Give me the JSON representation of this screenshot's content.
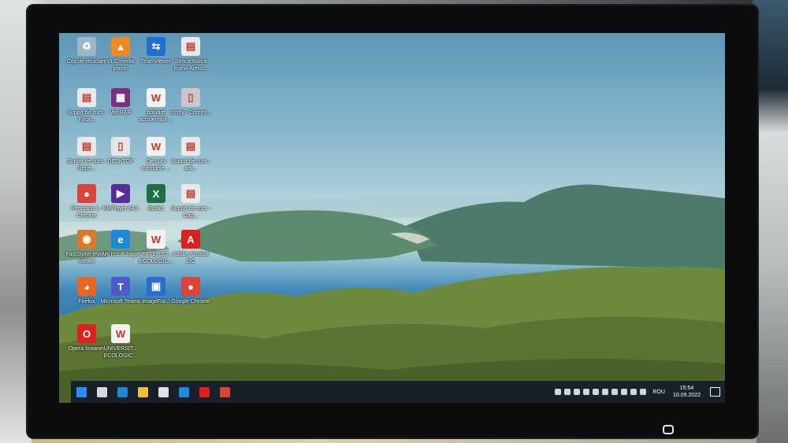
{
  "desktop_icons": [
    {
      "label": "Coș de reciclare",
      "icon": "recycle-bin-icon",
      "color": "#9fb6c7",
      "glyph": "♻"
    },
    {
      "label": "VLC media player",
      "icon": "vlc-icon",
      "color": "#f08a1c",
      "glyph": "▲"
    },
    {
      "label": "TeamViewer",
      "icon": "teamviewer-icon",
      "color": "#1f6fd1",
      "glyph": "⇆"
    },
    {
      "label": "Senca-Burcă Ioana-Alexa...",
      "icon": "pdf-document-icon",
      "color": "#e9e9e9",
      "glyph": "▤"
    },
    {
      "label": "Suport de curs - Elisa...",
      "icon": "pdf-document-icon",
      "color": "#e9e9e9",
      "glyph": "▤"
    },
    {
      "label": "WinRAR",
      "icon": "winrar-icon",
      "color": "#7a2f83",
      "glyph": "▦"
    },
    {
      "label": "poluare accidentală ...",
      "icon": "word-document-icon",
      "color": "#f2f2f2",
      "glyph": "W"
    },
    {
      "label": "cossy - Comen...",
      "icon": "file-icon",
      "color": "#c8c8c8",
      "glyph": "▯"
    },
    {
      "label": "Suport de curs - Repe...",
      "icon": "pdf-document-icon",
      "color": "#e9e9e9",
      "glyph": "▤"
    },
    {
      "label": "DESKTOP",
      "icon": "folder-file-icon",
      "color": "#e6e6e6",
      "glyph": "▯"
    },
    {
      "label": "De-Luni metodele ...",
      "icon": "word-document-icon",
      "color": "#f2f2f2",
      "glyph": "W"
    },
    {
      "label": "Suport de curs - arti...",
      "icon": "pdf-document-icon",
      "color": "#e9e9e9",
      "glyph": "▤"
    },
    {
      "label": "Persoana 1 - Chrome",
      "icon": "chrome-icon",
      "color": "#db4437",
      "glyph": "●"
    },
    {
      "label": "KMPlayer 64X",
      "icon": "kmplayer-icon",
      "color": "#5a2c9a",
      "glyph": "▶"
    },
    {
      "label": "Book1",
      "icon": "excel-icon",
      "color": "#1d7044",
      "glyph": "X"
    },
    {
      "label": "Suport de curs - Cap...",
      "icon": "pdf-document-icon",
      "color": "#e9e9e9",
      "glyph": "▤"
    },
    {
      "label": "FastStone Image Viewer",
      "icon": "faststone-icon",
      "color": "#d87a2a",
      "glyph": "◉"
    },
    {
      "label": "Microsoft Edge",
      "icon": "edge-icon",
      "color": "#1a8ad6",
      "glyph": "e"
    },
    {
      "label": "UNIVERSIT... ECOLOGIC...",
      "icon": "word-document-icon",
      "color": "#f2f2f2",
      "glyph": "W"
    },
    {
      "label": "Adobe Acrobat DC",
      "icon": "acrobat-icon",
      "color": "#d6231f",
      "glyph": "A"
    },
    {
      "label": "Firefox",
      "icon": "firefox-icon",
      "color": "#e8661f",
      "glyph": "◕"
    },
    {
      "label": "Microsoft Teams",
      "icon": "teams-icon",
      "color": "#5059c9",
      "glyph": "T"
    },
    {
      "label": "ImageFor...",
      "icon": "imageforge-icon",
      "color": "#2a6dcc",
      "glyph": "▣"
    },
    {
      "label": "Google Chrome",
      "icon": "chrome-icon",
      "color": "#db4437",
      "glyph": "●"
    },
    {
      "label": "Opera browser",
      "icon": "opera-icon",
      "color": "#e0201f",
      "glyph": "O"
    },
    {
      "label": "UNIVERSIT... ECOLOGIC...",
      "icon": "word-document-icon",
      "color": "#f2f2f2",
      "glyph": "W"
    }
  ],
  "taskbar": {
    "pinned": [
      {
        "name": "start-button",
        "color": "#2b8cff"
      },
      {
        "name": "task-view-button",
        "color": "#d9d9d9"
      },
      {
        "name": "edge-taskbar-button",
        "color": "#1a8ad6"
      },
      {
        "name": "file-explorer-button",
        "color": "#f2c037"
      },
      {
        "name": "store-button",
        "color": "#e1e1e1"
      },
      {
        "name": "mail-button",
        "color": "#1f8be0"
      },
      {
        "name": "opera-taskbar-button",
        "color": "#e0201f"
      },
      {
        "name": "chrome-taskbar-button",
        "color": "#db4437"
      }
    ],
    "tray_icons": [
      "onedrive-icon",
      "tray-app-icon",
      "tray-app-icon",
      "usb-icon",
      "nvidia-icon",
      "tray-app-icon",
      "tray-app-icon",
      "battery-icon",
      "network-icon",
      "volume-icon"
    ],
    "language": "ROU",
    "time": "15:54",
    "date": "10.09.2022"
  },
  "colors": {
    "taskbar_bg": "#141c28",
    "accent": "#2b8cff"
  }
}
